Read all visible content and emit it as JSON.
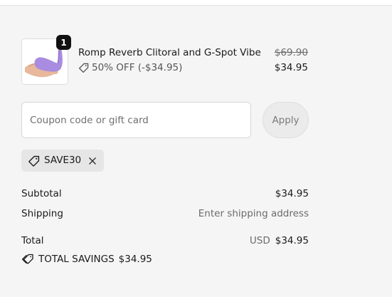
{
  "product": {
    "name": "Romp Reverb Clitoral and G-Spot Vibe",
    "quantity": "1",
    "discount_text": "50% OFF (-$34.95)",
    "original_price": "$69.90",
    "price": "$34.95",
    "image_icon": "product-thumbnail"
  },
  "coupon": {
    "placeholder": "Coupon code or gift card",
    "apply_label": "Apply"
  },
  "applied_code": {
    "code": "SAVE30",
    "tag_icon": "tag-icon",
    "remove_icon": "close-icon"
  },
  "summary": {
    "subtotal_label": "Subtotal",
    "subtotal_value": "$34.95",
    "shipping_label": "Shipping",
    "shipping_value": "Enter shipping address",
    "total_label": "Total",
    "currency": "USD",
    "total_value": "$34.95",
    "savings_label": "TOTAL SAVINGS",
    "savings_value": "$34.95"
  },
  "colors": {
    "panel_bg": "#f5f5f5",
    "chip_bg": "#e6e6e6",
    "badge_bg": "#111111",
    "product_purple": "#a98be0"
  }
}
